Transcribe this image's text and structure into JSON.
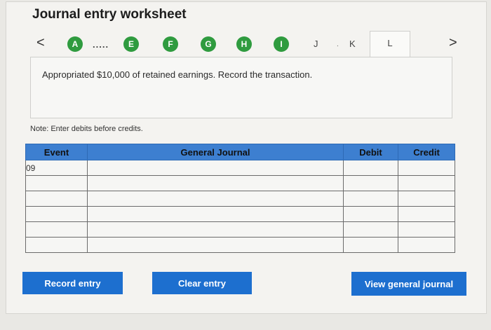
{
  "header": {
    "title": "Journal entry worksheet"
  },
  "nav": {
    "prev": "<",
    "next": ">",
    "dots": ".....",
    "steps": [
      "A",
      "E",
      "F",
      "G",
      "H",
      "I"
    ],
    "plain_tabs": [
      "J",
      "K"
    ],
    "small_dot": ".",
    "active_tab": "L"
  },
  "prompt": {
    "text": "Appropriated $10,000 of retained earnings. Record the transaction."
  },
  "note": "Note: Enter debits before credits.",
  "table": {
    "headers": {
      "event": "Event",
      "journal": "General Journal",
      "debit": "Debit",
      "credit": "Credit"
    },
    "rows": [
      {
        "event": "09"
      },
      {
        "event": ""
      },
      {
        "event": ""
      },
      {
        "event": ""
      },
      {
        "event": ""
      },
      {
        "event": ""
      }
    ]
  },
  "buttons": {
    "record": "Record entry",
    "clear": "Clear entry",
    "view": "View general journal"
  },
  "colors": {
    "step_green": "#2f9b3f",
    "header_blue": "#3d7fd0",
    "button_blue": "#1d6fcf"
  }
}
